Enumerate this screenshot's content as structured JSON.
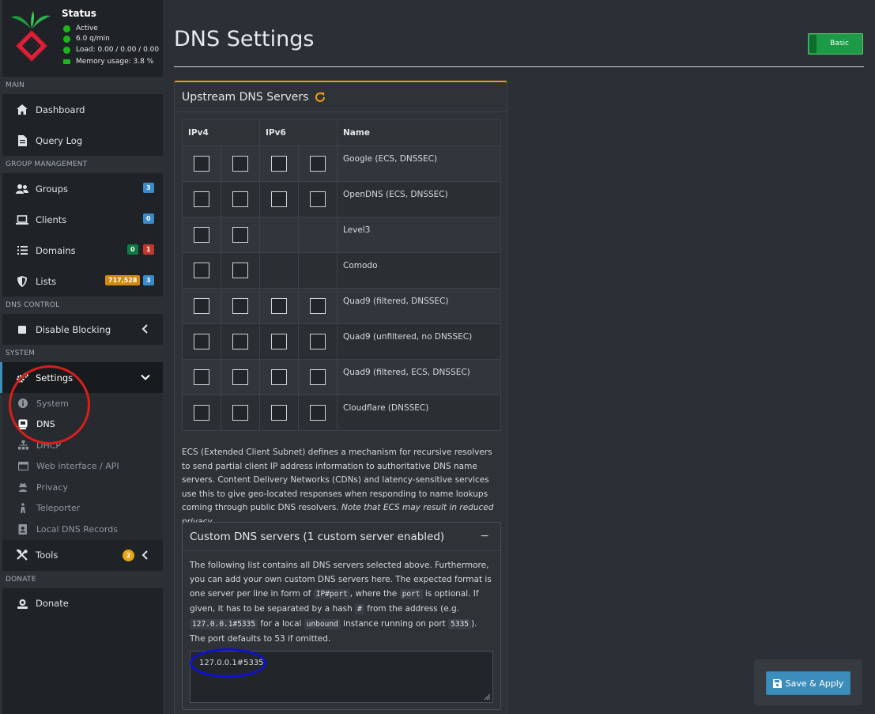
{
  "sidebar": {
    "status": {
      "title": "Status",
      "active": "Active",
      "queries": "6.0 q/min",
      "load": "Load: 0.00 / 0.00 / 0.00",
      "memory": "Memory usage: 3.8 %"
    },
    "sections": {
      "main": "MAIN",
      "group_management": "GROUP MANAGEMENT",
      "dns_control": "DNS CONTROL",
      "system": "SYSTEM",
      "donate": "DONATE"
    },
    "items": {
      "dashboard": "Dashboard",
      "query_log": "Query Log",
      "groups": "Groups",
      "groups_badge": "3",
      "clients": "Clients",
      "clients_badge": "0",
      "domains": "Domains",
      "domains_badge_allow": "0",
      "domains_badge_deny": "1",
      "lists": "Lists",
      "lists_badge_domains": "717,528",
      "lists_badge_count": "3",
      "disable_blocking": "Disable Blocking",
      "settings": "Settings",
      "tools": "Tools",
      "tools_badge": "2",
      "donate": "Donate"
    },
    "settings_sub": {
      "system": "System",
      "dns": "DNS",
      "dhcp": "DHCP",
      "web_interface": "Web interface / API",
      "privacy": "Privacy",
      "teleporter": "Teleporter",
      "local_dns": "Local DNS Records"
    }
  },
  "header": {
    "title": "DNS Settings",
    "mode_toggle": "Basic"
  },
  "upstream": {
    "title": "Upstream DNS Servers",
    "columns": {
      "ipv4": "IPv4",
      "ipv6": "IPv6",
      "name": "Name"
    },
    "servers": [
      "Google (ECS, DNSSEC)",
      "OpenDNS (ECS, DNSSEC)",
      "Level3",
      "Comodo",
      "Quad9 (filtered, DNSSEC)",
      "Quad9 (unfiltered, no DNSSEC)",
      "Quad9 (filtered, ECS, DNSSEC)",
      "Cloudflare (DNSSEC)"
    ],
    "ecs_text": "ECS (Extended Client Subnet) defines a mechanism for recursive resolvers to send partial client IP address information to authoritative DNS name servers. Content Delivery Networks (CDNs) and latency-sensitive services use this to give geo-located responses when responding to name lookups coming through public DNS resolvers.",
    "ecs_note": "Note that ECS may result in reduced privacy."
  },
  "custom": {
    "title": "Custom DNS servers (1 custom server enabled)",
    "collapse": "−",
    "p1": "The following list contains all DNS servers selected above. Furthermore, you can add your own custom DNS servers here. The expected format is one server per line in form of",
    "code1": "IP#port",
    "p2": ", where the",
    "code2": "port",
    "p3": "is optional. If given, it has to be separated by a hash",
    "code3": "#",
    "p4": "from the address (e.g.",
    "code4": "127.0.0.1#5335",
    "p5": "for a local",
    "code5": "unbound",
    "p6": "instance running on port",
    "code6": "5335",
    "p7": "). The port defaults to 53 if omitted.",
    "value": "127.0.0.1#5335"
  },
  "actions": {
    "save": "Save & Apply"
  },
  "colors": {
    "accent": "#3c8dbc",
    "box_border": "#f39c12",
    "toggle": "#1c9a45",
    "annotation_red": "#d91e1e",
    "annotation_blue": "#1010d8"
  }
}
